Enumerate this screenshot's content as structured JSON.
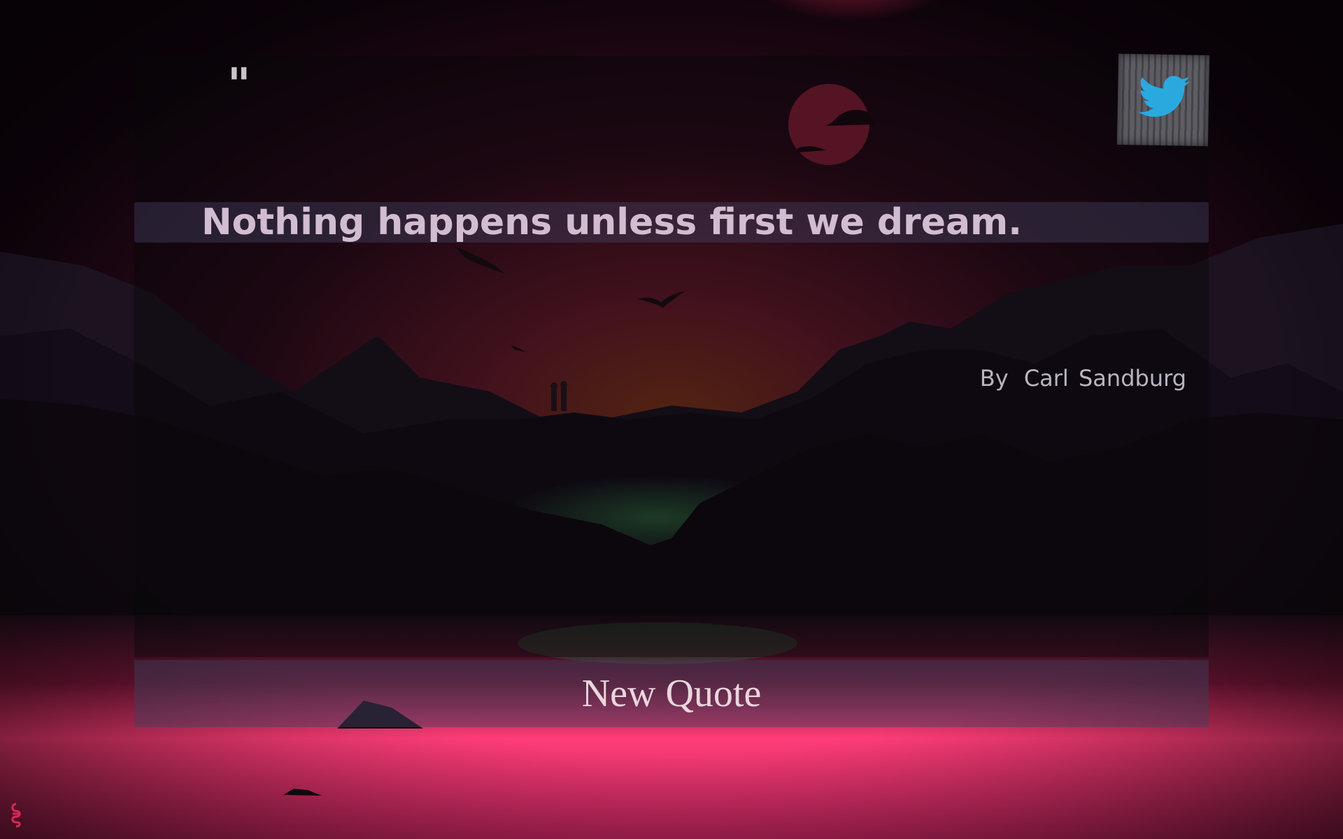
{
  "quote": {
    "mark": "\"",
    "text": "Nothing happens unless first we dream.",
    "author_prefix": "By",
    "author": "Carl Sandburg"
  },
  "actions": {
    "new_quote_label": "New Quote",
    "tweet_icon": "twitter-bird-icon"
  },
  "colors": {
    "sky_top": "#1a0614",
    "sky_glow": "#6e1a2a",
    "horizon_glow": "#8a3a1a",
    "water_pink": "#ff3a7a",
    "moon": "#8c1e36",
    "twitter_blue": "#2aa9e0"
  }
}
